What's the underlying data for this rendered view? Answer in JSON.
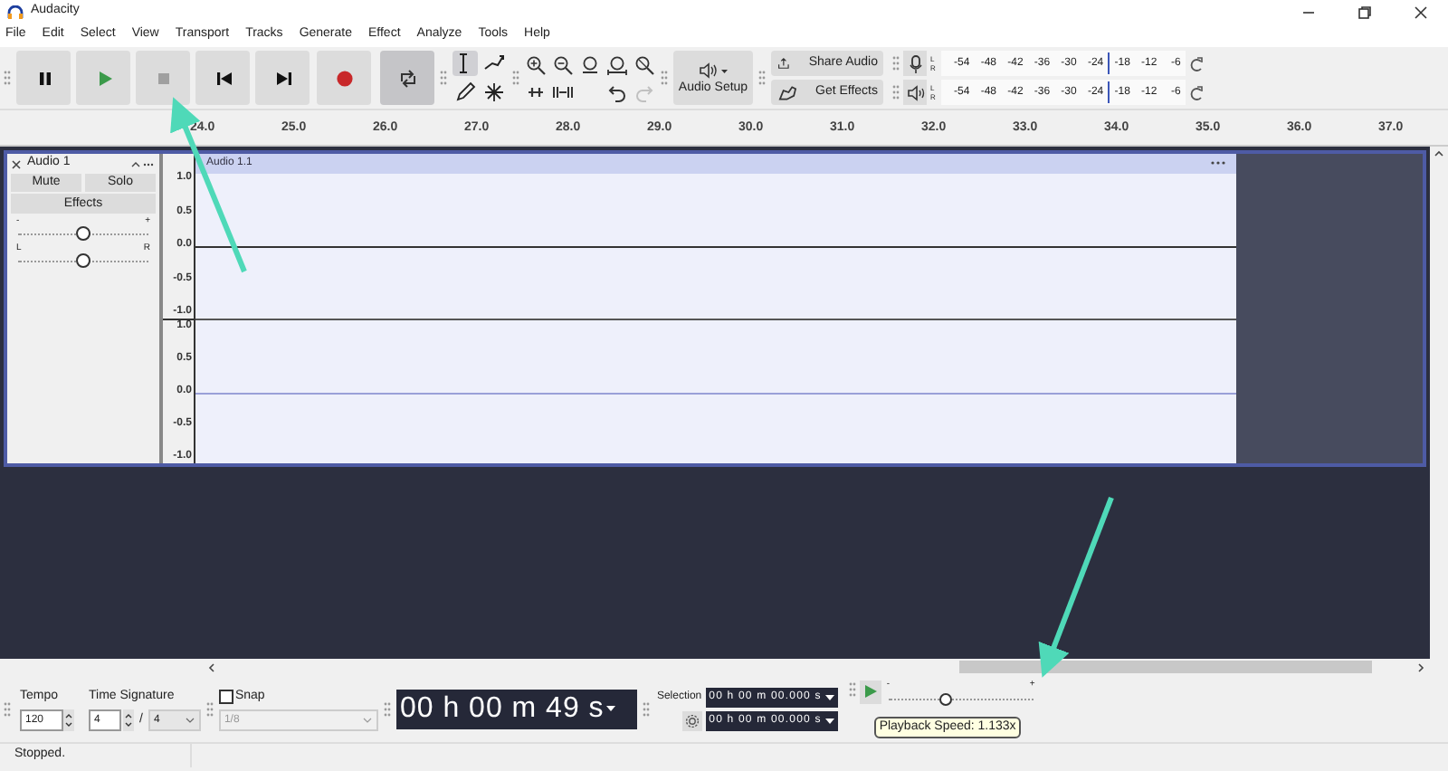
{
  "window": {
    "title": "Audacity"
  },
  "menu": [
    "File",
    "Edit",
    "Select",
    "View",
    "Transport",
    "Tracks",
    "Generate",
    "Effect",
    "Analyze",
    "Tools",
    "Help"
  ],
  "transport": [
    {
      "kind": "pause",
      "on": false
    },
    {
      "kind": "play",
      "on": false
    },
    {
      "kind": "stop",
      "on": false
    },
    {
      "kind": "skip_start",
      "on": false
    },
    {
      "kind": "skip_end",
      "on": false
    },
    {
      "kind": "record",
      "on": false
    },
    {
      "kind": "loop",
      "on": true
    }
  ],
  "tools": [
    {
      "kind": "select",
      "selected": true
    },
    {
      "kind": "envelope",
      "selected": false
    },
    {
      "kind": "draw",
      "selected": false
    },
    {
      "kind": "multi",
      "selected": false
    }
  ],
  "history": [
    {
      "kind": "undo",
      "disabled": false
    },
    {
      "kind": "redo",
      "disabled": true
    }
  ],
  "audio_setup": {
    "label": "Audio Setup"
  },
  "share": [
    {
      "kind": "share",
      "label": "Share Audio"
    },
    {
      "kind": "effects",
      "label": "Get Effects"
    }
  ],
  "meters": [
    {
      "kind": "record",
      "channels": [
        "L",
        "R"
      ],
      "ticks": [
        "-54",
        "-48",
        "-42",
        "-36",
        "-30",
        "-24",
        "-18",
        "-12",
        "-6"
      ]
    },
    {
      "kind": "playback",
      "channels": [
        "L",
        "R"
      ],
      "ticks": [
        "-54",
        "-48",
        "-42",
        "-36",
        "-30",
        "-24",
        "-18",
        "-12",
        "-6"
      ]
    }
  ],
  "ruler": [
    "24.0",
    "25.0",
    "26.0",
    "27.0",
    "28.0",
    "29.0",
    "30.0",
    "31.0",
    "32.0",
    "33.0",
    "34.0",
    "35.0",
    "36.0",
    "37.0"
  ],
  "track": {
    "name": "Audio 1",
    "selected": true,
    "mute": "Mute",
    "solo": "Solo",
    "effects": "Effects",
    "gain": {
      "min": "-",
      "max": "+",
      "level": 0.5
    },
    "pan": {
      "min": "L",
      "max": "R",
      "level": 0.5
    },
    "clip": "Audio 1.1",
    "channels": [
      {
        "scale": [
          "1.0",
          "0.5",
          "0.0",
          "-0.5",
          "-1.0"
        ]
      },
      {
        "scale": [
          "1.0",
          "0.5",
          "0.0",
          "-0.5",
          "-1.0"
        ]
      }
    ]
  },
  "tempo": {
    "label": "Tempo",
    "value": "120"
  },
  "time_signature": {
    "label": "Time Signature",
    "numerator": "4",
    "separator": "/",
    "denominator": "4"
  },
  "snap": {
    "label": "Snap",
    "checked": false,
    "value": "1/8",
    "disabled": true
  },
  "time": "00 h 00 m 49 s",
  "selection": {
    "label": "Selection",
    "start": "00 h 00 m 00.000 s",
    "end": "00 h 00 m 00.000 s"
  },
  "play_at_speed": {
    "min": "-",
    "max": "+",
    "level": 0.4,
    "tooltip": "Playback Speed: 1.133x"
  },
  "status": "Stopped."
}
